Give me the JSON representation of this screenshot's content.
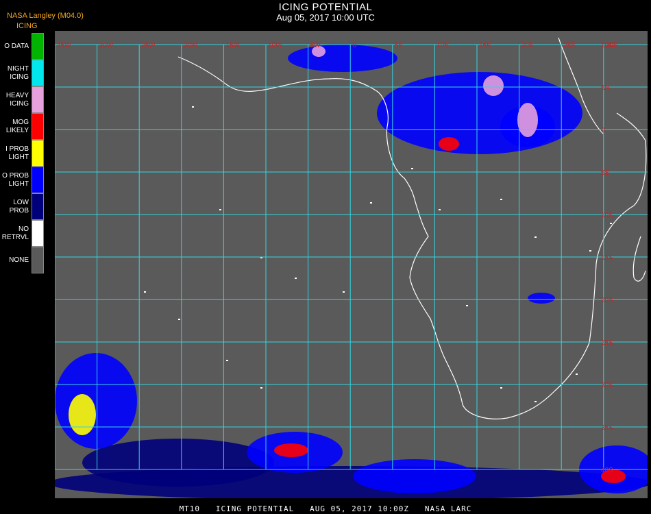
{
  "header": {
    "source": "NASA Langley (M04.0)",
    "product": "ICING",
    "title": "ICING POTENTIAL",
    "subtitle": "Aug 05, 2017 10:00 UTC"
  },
  "legend": [
    {
      "label": "O DATA",
      "color": "#00b400"
    },
    {
      "label": "NIGHT\nICING",
      "color": "#00e8ee"
    },
    {
      "label": "HEAVY\nICING",
      "color": "#e6a0dc"
    },
    {
      "label": "MOG\nLIKELY",
      "color": "#ff0000"
    },
    {
      "label": "I PROB\nLIGHT",
      "color": "#ffff00"
    },
    {
      "label": "O PROB\nLIGHT",
      "color": "#0000ff"
    },
    {
      "label": "LOW\nPROB",
      "color": "#00007a"
    },
    {
      "label": "NO\nRETRVL",
      "color": "#ffffff"
    },
    {
      "label": "NONE",
      "color": "#5a5a5a"
    }
  ],
  "map": {
    "background_color": "#5a5a5a",
    "grid_color": "#33d6e0",
    "coast_color": "#ffffff",
    "lon_labels": [
      "35W",
      "30W",
      "25W",
      "20W",
      "15W",
      "10W",
      "5W",
      "0",
      "5E",
      "10E",
      "15E",
      "20E",
      "25E",
      "30E"
    ],
    "lat_labels": [
      "10N",
      "5N",
      "0",
      "5S",
      "10S",
      "15S",
      "20S",
      "25S",
      "30S",
      "35S",
      "40S"
    ]
  },
  "footer": "MT10   ICING POTENTIAL   AUG 05, 2017 10:00Z   NASA LARC"
}
